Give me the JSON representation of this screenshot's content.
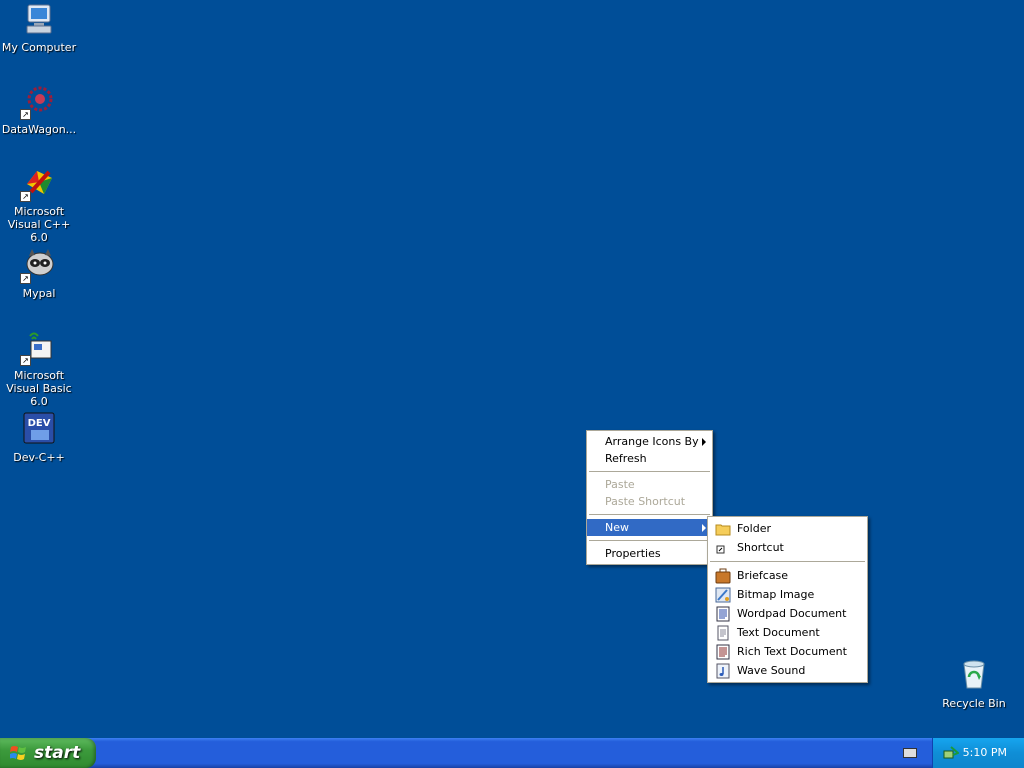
{
  "desktop": {
    "background": "#004e98",
    "icons": [
      {
        "label": "My Computer",
        "icon": "computer-icon"
      },
      {
        "label": "DataWagon...",
        "icon": "datawagon-icon"
      },
      {
        "label": "Microsoft Visual C++ 6.0",
        "icon": "visual-cpp-icon"
      },
      {
        "label": "Mypal",
        "icon": "mypal-icon"
      },
      {
        "label": "Microsoft Visual Basic 6.0",
        "icon": "visual-basic-icon"
      },
      {
        "label": "Dev-C++",
        "icon": "dev-cpp-icon"
      },
      {
        "label": "Recycle Bin",
        "icon": "recycle-bin-icon"
      }
    ]
  },
  "context_menu": {
    "items": [
      {
        "label": "Arrange Icons By"
      },
      {
        "label": "Refresh"
      },
      {
        "label": "Paste"
      },
      {
        "label": "Paste Shortcut"
      },
      {
        "label": "New"
      },
      {
        "label": "Properties"
      }
    ]
  },
  "new_submenu": {
    "items": [
      {
        "label": "Folder",
        "icon": "folder-icon"
      },
      {
        "label": "Shortcut",
        "icon": "shortcut-icon"
      },
      {
        "label": "Briefcase",
        "icon": "briefcase-icon"
      },
      {
        "label": "Bitmap Image",
        "icon": "bitmap-icon"
      },
      {
        "label": "Wordpad Document",
        "icon": "wordpad-icon"
      },
      {
        "label": "Text Document",
        "icon": "text-document-icon"
      },
      {
        "label": "Rich Text Document",
        "icon": "rich-text-icon"
      },
      {
        "label": "Wave Sound",
        "icon": "wave-sound-icon"
      }
    ]
  },
  "taskbar": {
    "start_label": "start",
    "clock": "5:10 PM"
  },
  "colors": {
    "highlight": "#316ac5",
    "taskbar": "#245edb",
    "start_green": "#3c9a3c",
    "tray": "#0f8ed6"
  }
}
